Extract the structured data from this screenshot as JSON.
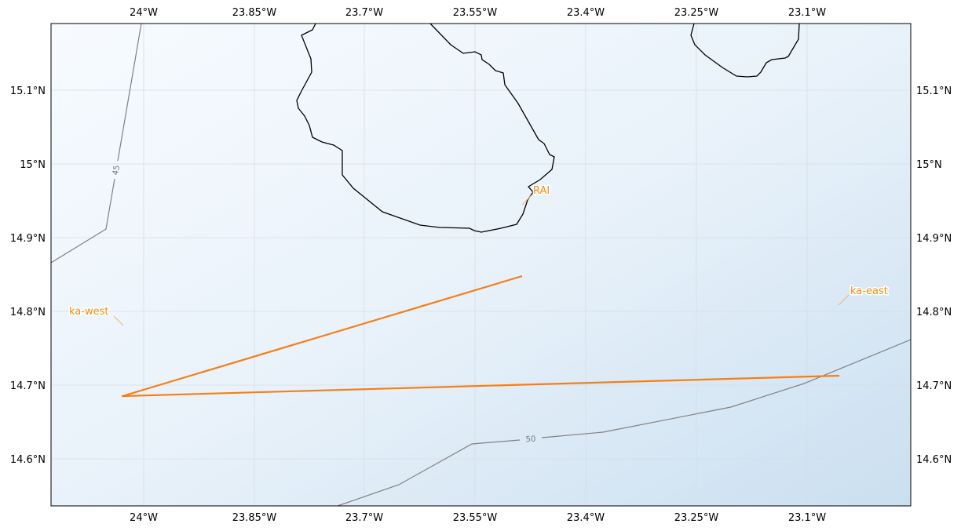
{
  "map": {
    "lon_ticks": [
      "24°W",
      "23.85°W",
      "23.7°W",
      "23.55°W",
      "23.4°W",
      "23.25°W",
      "23.1°W"
    ],
    "lat_ticks": [
      "15.1°N",
      "15°N",
      "14.9°N",
      "14.8°N",
      "14.7°N",
      "14.6°N"
    ],
    "contour_labels": [
      "45",
      "50"
    ],
    "labels": {
      "rai": "RAI",
      "ka_west": "ka-west",
      "ka_east": "ka-east"
    },
    "colors": {
      "track": "#f57f17",
      "label": "#f28c0f",
      "coastline": "#000000",
      "contour": "#808080",
      "grid": "#d8dde3",
      "bg_light": "#f7fbff",
      "bg_dark": "#cadff0"
    }
  }
}
